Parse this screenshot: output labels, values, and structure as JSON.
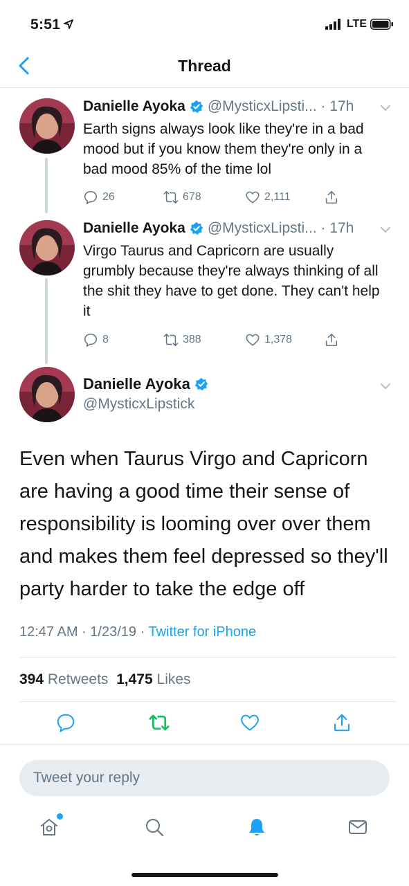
{
  "status_bar": {
    "time": "5:51",
    "network": "LTE"
  },
  "nav": {
    "title": "Thread"
  },
  "thread": [
    {
      "name": "Danielle Ayoka",
      "handle": "@MysticxLipsti...",
      "time": "17h",
      "text": "Earth signs always look like they're in a bad mood but if you know them they're only in a bad mood 85% of the time lol",
      "replies": "26",
      "retweets": "678",
      "likes": "2,111"
    },
    {
      "name": "Danielle Ayoka",
      "handle": "@MysticxLipsti...",
      "time": "17h",
      "text": "Virgo Taurus and Capricorn are usually grumbly because they're always thinking of all the shit they have to get done. They can't help it",
      "replies": "8",
      "retweets": "388",
      "likes": "1,378"
    }
  ],
  "focused": {
    "name": "Danielle Ayoka",
    "handle": "@MysticxLipstick",
    "text": "Even when Taurus Virgo and Capricorn are having a good time their sense of responsibility is looming over over them and makes them feel depressed so they'll party harder to take the edge off",
    "time": "12:47 AM",
    "date": "1/23/19",
    "source": "Twitter for iPhone",
    "retweet_count": "394",
    "retweet_label": "Retweets",
    "like_count": "1,475",
    "like_label": "Likes"
  },
  "reply": {
    "placeholder": "Tweet your reply"
  },
  "colors": {
    "accent": "#1da1f2",
    "retweet_green": "#17bf63",
    "muted": "#657786",
    "line": "#ccd6dd"
  },
  "icons": [
    "back-chevron-icon",
    "verified-badge-icon",
    "reply-icon",
    "retweet-icon",
    "like-icon",
    "share-icon",
    "home-icon",
    "search-icon",
    "notifications-bell-icon",
    "messages-icon"
  ]
}
